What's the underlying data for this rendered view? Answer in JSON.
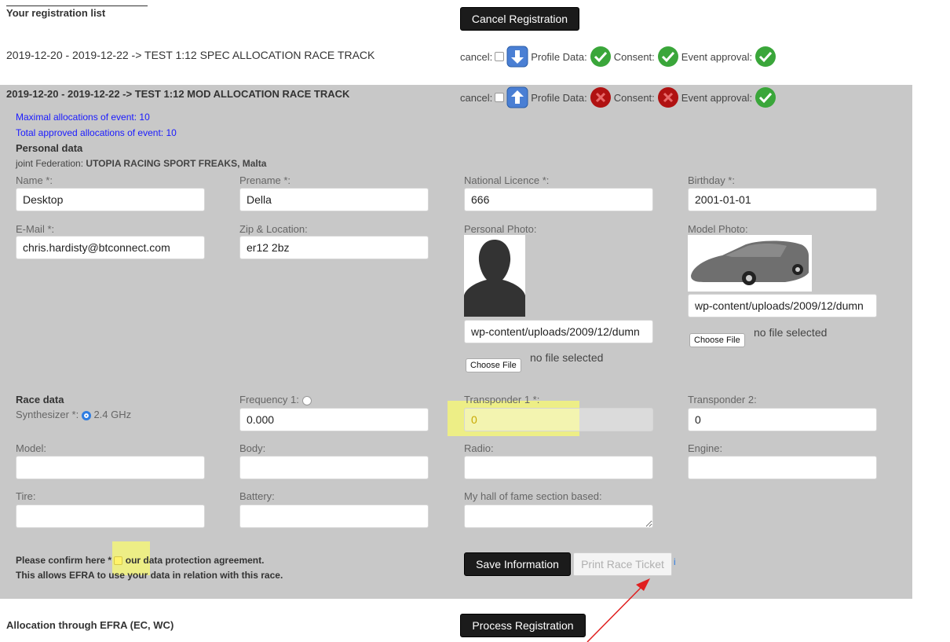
{
  "header": {
    "title": "Your registration list",
    "cancel_button": "Cancel Registration"
  },
  "registrations": [
    {
      "label": "2019-12-20 - 2019-12-22 -> TEST 1:12 SPEC ALLOCATION RACE TRACK",
      "cancel_label": "cancel:",
      "profile_label": "Profile Data:",
      "consent_label": "Consent:",
      "approval_label": "Event approval:",
      "profile_ok": true,
      "consent_ok": true,
      "approval_ok": true,
      "expanded": false
    },
    {
      "label": "2019-12-20 - 2019-12-22 -> TEST 1:12 MOD ALLOCATION RACE TRACK",
      "cancel_label": "cancel:",
      "profile_label": "Profile Data:",
      "consent_label": "Consent:",
      "approval_label": "Event approval:",
      "profile_ok": false,
      "consent_ok": false,
      "approval_ok": true,
      "expanded": true
    }
  ],
  "event": {
    "max_alloc": "Maximal allocations of event: 10",
    "total_alloc": "Total approved allocations of event: 10",
    "personal_heading": "Personal data",
    "federation_prefix": "joint Federation:",
    "federation": "UTOPIA RACING SPORT FREAKS, Malta"
  },
  "personal": {
    "name_label": "Name *:",
    "name": "Desktop",
    "prename_label": "Prename *:",
    "prename": "Della",
    "licence_label": "National Licence *:",
    "licence": "666",
    "birthday_label": "Birthday *:",
    "birthday": "2001-01-01",
    "email_label": "E-Mail *:",
    "email": "chris.hardisty@btconnect.com",
    "zip_label": "Zip & Location:",
    "zip": "er12 2bz",
    "photo_label": "Personal Photo:",
    "photo_path": "wp-content/uploads/2009/12/dumn",
    "model_photo_label": "Model Photo:",
    "model_photo_path": "wp-content/uploads/2009/12/dumn",
    "choose_file": "Choose File",
    "no_file": "no file selected"
  },
  "race": {
    "heading": "Race data",
    "synth_label": "Synthesizer *:",
    "synth_value": "2.4 GHz",
    "freq_label": "Frequency 1:",
    "freq": "0.000",
    "tp1_label": "Transponder 1 *:",
    "tp1": "0",
    "tp2_label": "Transponder 2:",
    "tp2": "0",
    "model_label": "Model:",
    "body_label": "Body:",
    "radio_label": "Radio:",
    "engine_label": "Engine:",
    "tire_label": "Tire:",
    "battery_label": "Battery:",
    "hof_label": "My hall of fame section based:"
  },
  "confirm": {
    "line1_a": "Please confirm here *",
    "line1_b": "our data protection agreement.",
    "line2": "This allows EFRA to use your data in relation with this race.",
    "save_button": "Save Information",
    "print_button": "Print Race Ticket",
    "info_icon": "i"
  },
  "footer": {
    "label": "Allocation through EFRA (EC, WC)",
    "process_button": "Process Registration"
  },
  "colors": {
    "panel": "#c8c8c8",
    "highlight": "#f3f47a",
    "link_blue": "#1a1aff",
    "ok_green": "#3aa63a",
    "bad_red": "#b01212",
    "arrow_blue": "#4a7fd4",
    "annotation_red": "#e02020"
  }
}
